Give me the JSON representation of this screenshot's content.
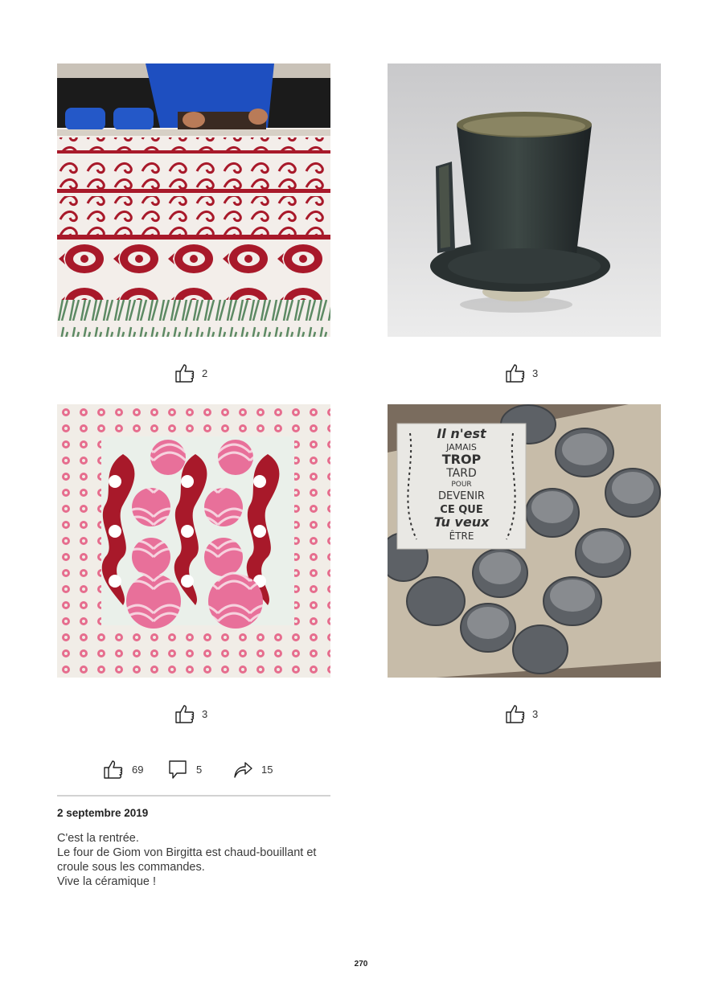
{
  "posts": [
    {
      "image": "block-printed textile with red paisley motifs being stamped",
      "likes": "2"
    },
    {
      "image": "dark glazed ceramic cup with flat handle",
      "likes": "3"
    },
    {
      "image": "block-printed textile with red and pink ogee motifs",
      "likes": "3"
    },
    {
      "image": "unglazed grey ceramic cups around a sign",
      "likes": "3",
      "sign_lines": [
        "Il n'est",
        "JAMAIS",
        "TROP",
        "TARD",
        "POUR",
        "DEVENIR",
        "CE QUE",
        "Tu veux",
        "ÊTRE"
      ]
    }
  ],
  "summary": {
    "likes": "69",
    "comments": "5",
    "shares": "15"
  },
  "entry": {
    "date": "2 septembre 2019",
    "lines": [
      "C'est la rentrée.",
      "Le four de Giom von Birgitta est chaud-bouillant et",
      "croule sous les commandes.",
      "Vive la céramique !"
    ]
  },
  "page_number": "270",
  "icons": {
    "like": "thumbs-up-icon",
    "comment": "comment-bubble-icon",
    "share": "share-arrow-icon"
  },
  "colors": {
    "text": "#2b2b2b",
    "rule": "#d2d2d2",
    "print_red": "#a8192a",
    "print_pink": "#e8709a"
  }
}
